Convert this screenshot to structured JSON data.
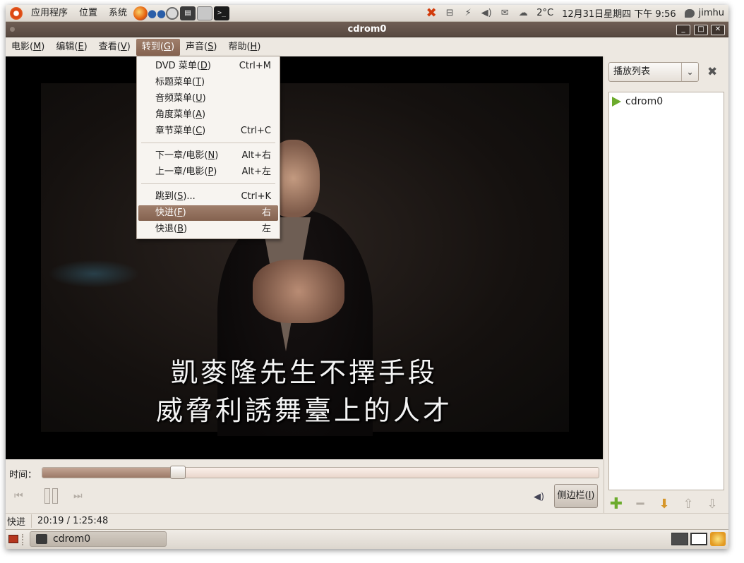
{
  "top_panel": {
    "applications": "应用程序",
    "places": "位置",
    "system": "系统",
    "weather": "2°C",
    "clock": "12月31日星期四 下午 9:56",
    "user": "jimhu"
  },
  "window": {
    "title": "cdrom0",
    "minimize_glyph": "_",
    "maximize_glyph": "□",
    "close_glyph": "✕"
  },
  "menubar": [
    {
      "pre": "电影(",
      "key": "M",
      "post": ")"
    },
    {
      "pre": "编辑(",
      "key": "E",
      "post": ")"
    },
    {
      "pre": "查看(",
      "key": "V",
      "post": ")"
    },
    {
      "pre": "转到(",
      "key": "G",
      "post": ")"
    },
    {
      "pre": "声音(",
      "key": "S",
      "post": ")"
    },
    {
      "pre": "帮助(",
      "key": "H",
      "post": ")"
    }
  ],
  "goto_menu": [
    {
      "pre": "DVD 菜单(",
      "key": "D",
      "post": ")",
      "accel": "Ctrl+M"
    },
    {
      "pre": "标题菜单(",
      "key": "T",
      "post": ")",
      "accel": ""
    },
    {
      "pre": "音频菜单(",
      "key": "U",
      "post": ")",
      "accel": ""
    },
    {
      "pre": "角度菜单(",
      "key": "A",
      "post": ")",
      "accel": ""
    },
    {
      "pre": "章节菜单(",
      "key": "C",
      "post": ")",
      "accel": "Ctrl+C"
    },
    {
      "pre": "下一章/电影(",
      "key": "N",
      "post": ")",
      "accel": "Alt+右"
    },
    {
      "pre": "上一章/电影(",
      "key": "P",
      "post": ")",
      "accel": "Alt+左"
    },
    {
      "pre": "跳到(",
      "key": "S",
      "post": ")...",
      "accel": "Ctrl+K"
    },
    {
      "pre": "快进(",
      "key": "F",
      "post": ")",
      "accel": "右"
    },
    {
      "pre": "快退(",
      "key": "B",
      "post": ")",
      "accel": "左"
    }
  ],
  "video": {
    "subtitle_line_1": "凱麥隆先生不擇手段",
    "subtitle_line_2": "威脅利誘舞臺上的人才"
  },
  "sidebar": {
    "combo_label": "播放列表",
    "playlist_items": [
      "cdrom0"
    ]
  },
  "controls": {
    "time_label": "时间：",
    "seek_fraction": 0.245,
    "sidebar_button_pre": "侧边栏(",
    "sidebar_button_key": "I",
    "sidebar_button_post": ")"
  },
  "statusbar": {
    "mode": "快进",
    "time": "20:19 / 1:25:48"
  },
  "bottom_panel": {
    "task": "cdrom0"
  },
  "colors": {
    "accent_brown": "#84624f",
    "play_green": "#6cab2d"
  }
}
